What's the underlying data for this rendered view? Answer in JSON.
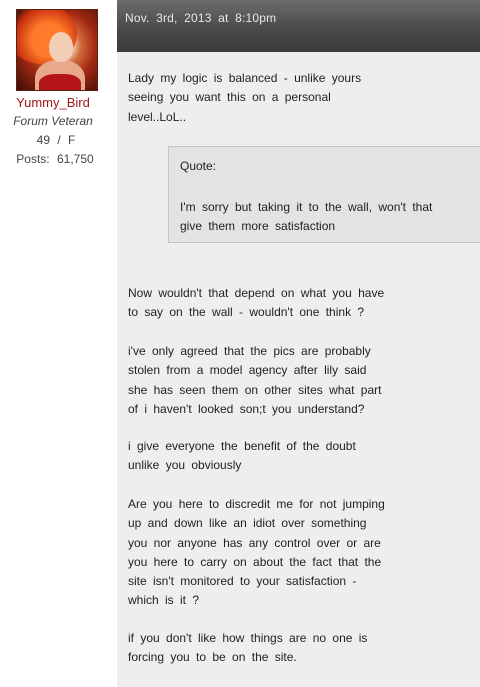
{
  "user": {
    "name": "Yummy_Bird",
    "title": "Forum Veteran",
    "age_gender": "49 / F",
    "posts": "Posts: 61,750"
  },
  "post": {
    "date": "Nov. 3rd, 2013 at 8:10pm",
    "intro": "Lady my logic is balanced - unlike yours seeing you want this on a personal level..LoL..",
    "quote_label": "Quote:",
    "quote_text": "I'm sorry but taking it to the wall, won't that give them more satisfaction",
    "paragraphs": [
      "Now wouldn't that depend on what you have to say on the wall - wouldn't one think ?",
      "i've only agreed that the pics are probably stolen from a model agency after lily said she has seen them on other sites what part of i haven't looked son;t you understand?",
      "i give everyone the benefit of the doubt unlike you obviously",
      "Are you here to discredit me for not jumping up and down like an idiot over something you nor anyone has any control over or are you here to carry on about the fact that the site isn't monitored to your satisfaction - which is it ?",
      "if you don't like how things are no one is forcing you to be on the site."
    ]
  }
}
